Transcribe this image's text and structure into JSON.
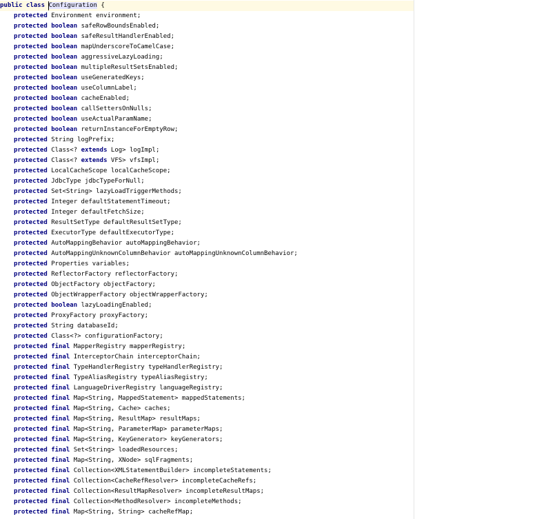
{
  "editor": {
    "header": {
      "prefix": "public class ",
      "class_name": "Configuration",
      "suffix": " {"
    },
    "fields": [
      {
        "access": "protected",
        "modifier": "",
        "type": "Environment environment;"
      },
      {
        "access": "protected",
        "modifier": "boolean",
        "type": "safeRowBoundsEnabled;"
      },
      {
        "access": "protected",
        "modifier": "boolean",
        "type": "safeResultHandlerEnabled;"
      },
      {
        "access": "protected",
        "modifier": "boolean",
        "type": "mapUnderscoreToCamelCase;"
      },
      {
        "access": "protected",
        "modifier": "boolean",
        "type": "aggressiveLazyLoading;"
      },
      {
        "access": "protected",
        "modifier": "boolean",
        "type": "multipleResultSetsEnabled;"
      },
      {
        "access": "protected",
        "modifier": "boolean",
        "type": "useGeneratedKeys;"
      },
      {
        "access": "protected",
        "modifier": "boolean",
        "type": "useColumnLabel;"
      },
      {
        "access": "protected",
        "modifier": "boolean",
        "type": "cacheEnabled;"
      },
      {
        "access": "protected",
        "modifier": "boolean",
        "type": "callSettersOnNulls;"
      },
      {
        "access": "protected",
        "modifier": "boolean",
        "type": "useActualParamName;"
      },
      {
        "access": "protected",
        "modifier": "boolean",
        "type": "returnInstanceForEmptyRow;"
      },
      {
        "access": "protected",
        "modifier": "",
        "type": "String logPrefix;"
      },
      {
        "access": "protected",
        "modifier": "",
        "type": "Class<? ",
        "kw2": "extends",
        "rest": " Log> logImpl;"
      },
      {
        "access": "protected",
        "modifier": "",
        "type": "Class<? ",
        "kw2": "extends",
        "rest": " VFS> vfsImpl;"
      },
      {
        "access": "protected",
        "modifier": "",
        "type": "LocalCacheScope localCacheScope;"
      },
      {
        "access": "protected",
        "modifier": "",
        "type": "JdbcType jdbcTypeForNull;"
      },
      {
        "access": "protected",
        "modifier": "",
        "type": "Set<String> lazyLoadTriggerMethods;"
      },
      {
        "access": "protected",
        "modifier": "",
        "type": "Integer defaultStatementTimeout;"
      },
      {
        "access": "protected",
        "modifier": "",
        "type": "Integer defaultFetchSize;"
      },
      {
        "access": "protected",
        "modifier": "",
        "type": "ResultSetType defaultResultSetType;"
      },
      {
        "access": "protected",
        "modifier": "",
        "type": "ExecutorType defaultExecutorType;"
      },
      {
        "access": "protected",
        "modifier": "",
        "type": "AutoMappingBehavior autoMappingBehavior;"
      },
      {
        "access": "protected",
        "modifier": "",
        "type": "AutoMappingUnknownColumnBehavior autoMappingUnknownColumnBehavior;"
      },
      {
        "access": "protected",
        "modifier": "",
        "type": "Properties variables;"
      },
      {
        "access": "protected",
        "modifier": "",
        "type": "ReflectorFactory reflectorFactory;"
      },
      {
        "access": "protected",
        "modifier": "",
        "type": "ObjectFactory objectFactory;"
      },
      {
        "access": "protected",
        "modifier": "",
        "type": "ObjectWrapperFactory objectWrapperFactory;"
      },
      {
        "access": "protected",
        "modifier": "boolean",
        "type": "lazyLoadingEnabled;"
      },
      {
        "access": "protected",
        "modifier": "",
        "type": "ProxyFactory proxyFactory;"
      },
      {
        "access": "protected",
        "modifier": "",
        "type": "String databaseId;"
      },
      {
        "access": "protected",
        "modifier": "",
        "type": "Class<?> configurationFactory;"
      },
      {
        "access": "protected",
        "modifier": "final",
        "type": "MapperRegistry mapperRegistry;"
      },
      {
        "access": "protected",
        "modifier": "final",
        "type": "InterceptorChain interceptorChain;"
      },
      {
        "access": "protected",
        "modifier": "final",
        "type": "TypeHandlerRegistry typeHandlerRegistry;"
      },
      {
        "access": "protected",
        "modifier": "final",
        "type": "TypeAliasRegistry typeAliasRegistry;"
      },
      {
        "access": "protected",
        "modifier": "final",
        "type": "LanguageDriverRegistry languageRegistry;"
      },
      {
        "access": "protected",
        "modifier": "final",
        "type": "Map<String, MappedStatement> mappedStatements;"
      },
      {
        "access": "protected",
        "modifier": "final",
        "type": "Map<String, Cache> caches;"
      },
      {
        "access": "protected",
        "modifier": "final",
        "type": "Map<String, ResultMap> resultMaps;"
      },
      {
        "access": "protected",
        "modifier": "final",
        "type": "Map<String, ParameterMap> parameterMaps;"
      },
      {
        "access": "protected",
        "modifier": "final",
        "type": "Map<String, KeyGenerator> keyGenerators;"
      },
      {
        "access": "protected",
        "modifier": "final",
        "type": "Set<String> loadedResources;"
      },
      {
        "access": "protected",
        "modifier": "final",
        "type": "Map<String, XNode> sqlFragments;"
      },
      {
        "access": "protected",
        "modifier": "final",
        "type": "Collection<XMLStatementBuilder> incompleteStatements;"
      },
      {
        "access": "protected",
        "modifier": "final",
        "type": "Collection<CacheRefResolver> incompleteCacheRefs;"
      },
      {
        "access": "protected",
        "modifier": "final",
        "type": "Collection<ResultMapResolver> incompleteResultMaps;"
      },
      {
        "access": "protected",
        "modifier": "final",
        "type": "Collection<MethodResolver> incompleteMethods;"
      },
      {
        "access": "protected",
        "modifier": "final",
        "type": "Map<String, String> cacheRefMap;"
      }
    ],
    "colors": {
      "keyword": "#000080",
      "text": "#000000",
      "line_highlight": "#fffae3",
      "selection": "#e4e4ff",
      "margin_line": "#e6e6e6"
    }
  }
}
